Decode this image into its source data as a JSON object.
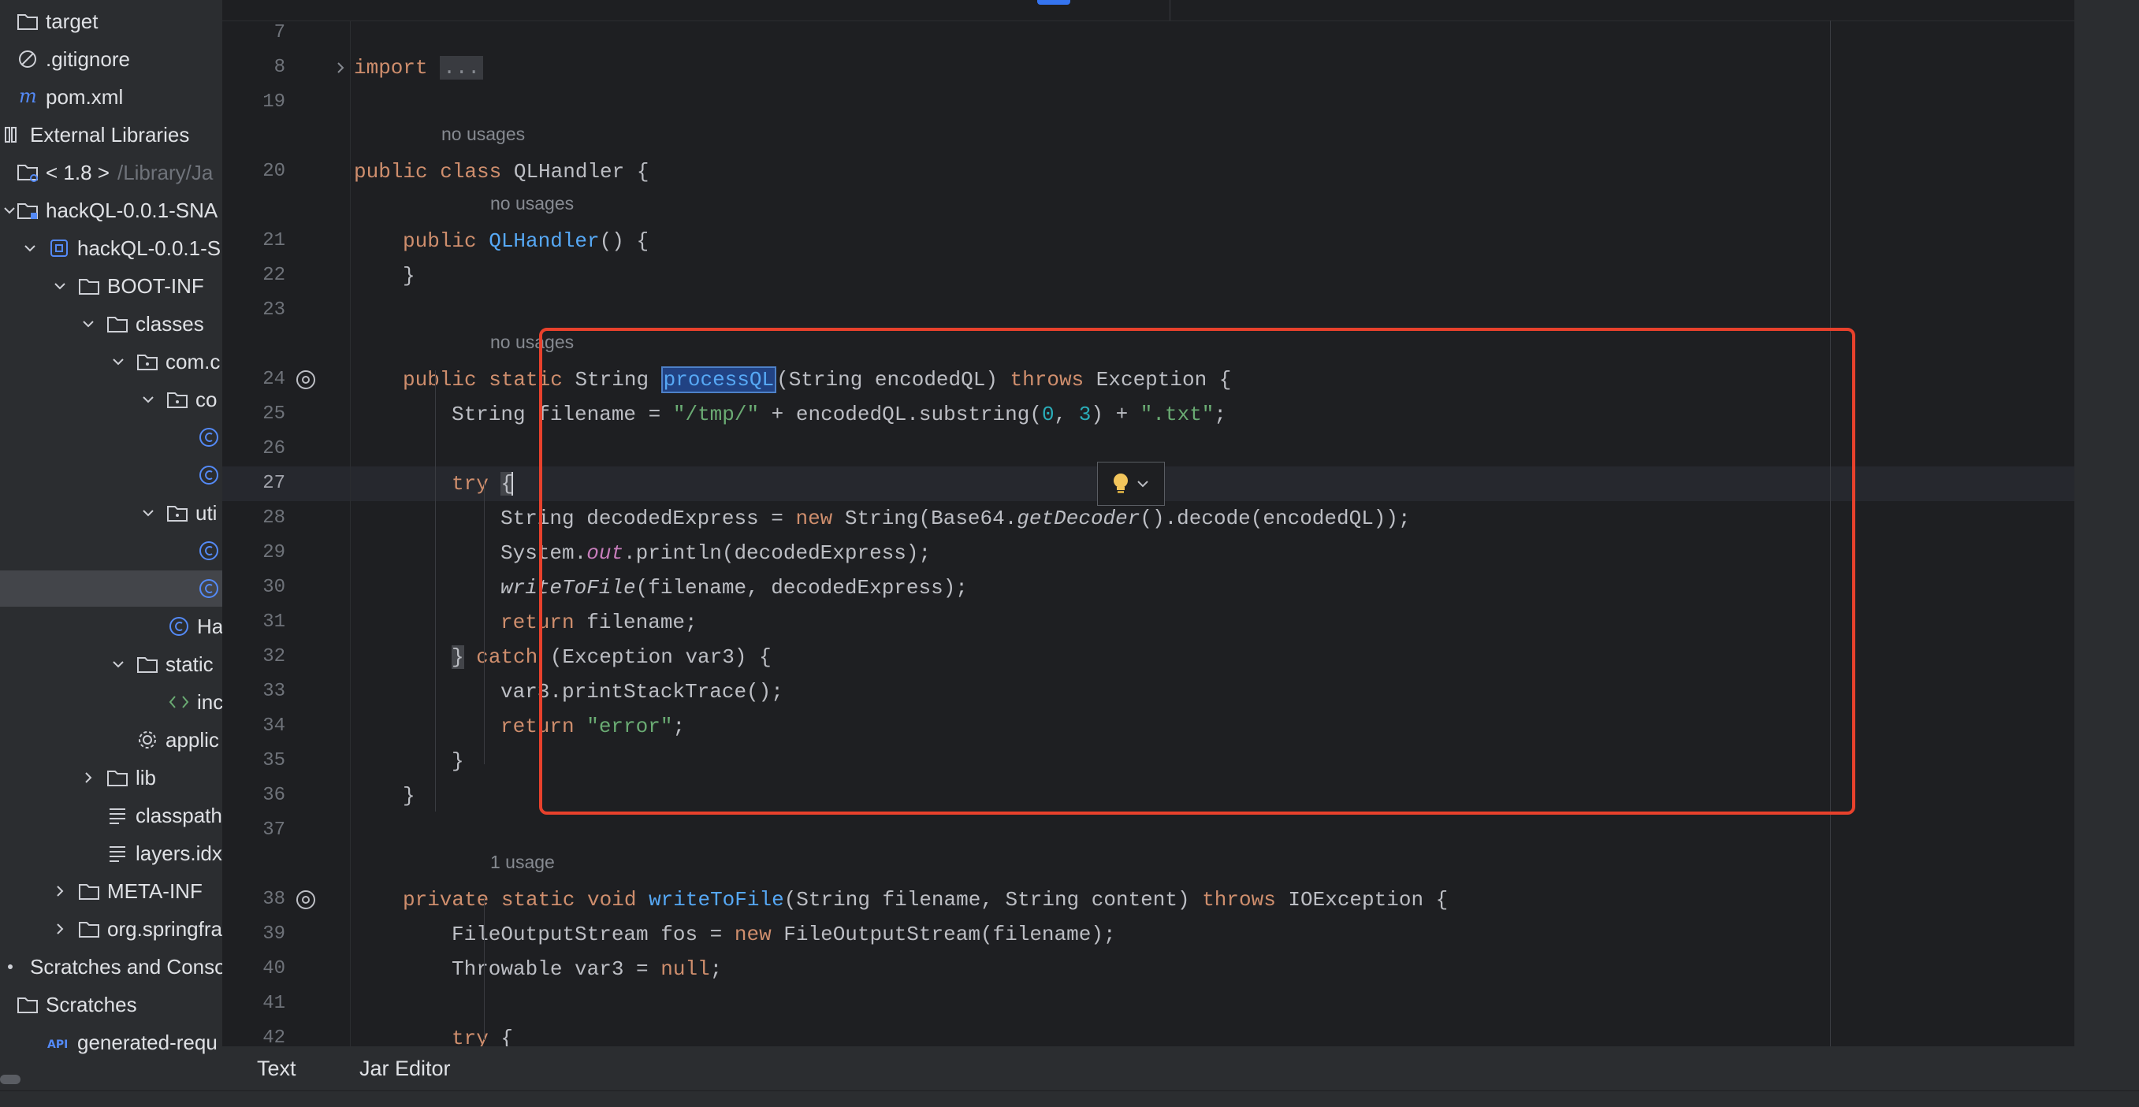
{
  "tree": [
    {
      "label": "target",
      "icon": "folder-icon",
      "indent": 20,
      "chev": "none"
    },
    {
      "label": ".gitignore",
      "icon": "ignore-file-icon",
      "indent": 20,
      "chev": "none"
    },
    {
      "label": "pom.xml",
      "icon": "maven-icon",
      "indent": 20,
      "chev": "none"
    },
    {
      "label": "External Libraries",
      "icon": "library-icon",
      "indent": 0,
      "chev": "none"
    },
    {
      "label": "< 1.8 >",
      "icon": "jdk-icon",
      "indent": 20,
      "chev": "none",
      "extra": "/Library/Ja"
    },
    {
      "label": "hackQL-0.0.1-SNA",
      "icon": "jar-folder-icon",
      "indent": 20,
      "chev": "down",
      "chev_left": 0
    },
    {
      "label": "hackQL-0.0.1-S",
      "icon": "jar-icon",
      "indent": 60,
      "chev": "down"
    },
    {
      "label": "BOOT-INF",
      "icon": "folder-icon",
      "indent": 98,
      "chev": "down"
    },
    {
      "label": "classes",
      "icon": "folder-icon",
      "indent": 134,
      "chev": "down"
    },
    {
      "label": "com.c",
      "icon": "package-icon",
      "indent": 172,
      "chev": "down"
    },
    {
      "label": "co",
      "icon": "package-icon",
      "indent": 210,
      "chev": "down"
    },
    {
      "label": "",
      "icon": "class-icon",
      "indent": 250,
      "chev": "none"
    },
    {
      "label": "",
      "icon": "class-icon",
      "indent": 250,
      "chev": "none"
    },
    {
      "label": "uti",
      "icon": "package-icon",
      "indent": 210,
      "chev": "down"
    },
    {
      "label": "",
      "icon": "class-icon",
      "indent": 250,
      "chev": "none"
    },
    {
      "label": "",
      "icon": "class-icon",
      "indent": 250,
      "chev": "none",
      "selected": true
    },
    {
      "label": "Ha",
      "icon": "class-icon",
      "indent": 212,
      "chev": "none"
    },
    {
      "label": "static",
      "icon": "folder-icon",
      "indent": 172,
      "chev": "down"
    },
    {
      "label": "inc",
      "icon": "html-icon",
      "indent": 212,
      "chev": "none"
    },
    {
      "label": "applic",
      "icon": "settings-file-icon",
      "indent": 172,
      "chev": "none"
    },
    {
      "label": "lib",
      "icon": "folder-icon",
      "indent": 134,
      "chev": "right"
    },
    {
      "label": "classpath",
      "icon": "text-file-icon",
      "indent": 134,
      "chev": "none"
    },
    {
      "label": "layers.idx",
      "icon": "text-file-icon",
      "indent": 134,
      "chev": "none"
    },
    {
      "label": "META-INF",
      "icon": "folder-icon",
      "indent": 98,
      "chev": "right"
    },
    {
      "label": "org.springfra",
      "icon": "folder-icon",
      "indent": 98,
      "chev": "right"
    },
    {
      "label": "Scratches and Conso",
      "icon": "scratches-icon",
      "indent": 0,
      "chev": "none"
    },
    {
      "label": "Scratches",
      "icon": "folder-icon",
      "indent": 20,
      "chev": "none"
    },
    {
      "label": "generated-requ",
      "icon": "api-icon",
      "indent": 60,
      "chev": "none"
    }
  ],
  "editor": {
    "lines": [
      {
        "n": "7",
        "indent": 0,
        "tokens": []
      },
      {
        "n": "8",
        "indent": 0,
        "fold": true,
        "tokens": [
          {
            "t": "import ",
            "c": "kw"
          },
          {
            "t": "...",
            "c": "fold-box"
          }
        ]
      },
      {
        "n": "19",
        "indent": 0,
        "tokens": []
      },
      {
        "n": "20",
        "indent": 0,
        "hint": "no usages",
        "tokens": [
          {
            "t": "public class ",
            "c": "kw"
          },
          {
            "t": "QLHandler {"
          }
        ]
      },
      {
        "n": "21",
        "indent": 1,
        "hint": "no usages",
        "tokens": [
          {
            "t": "public ",
            "c": "kw"
          },
          {
            "t": "QLHandler",
            "c": "fn"
          },
          {
            "t": "() {"
          }
        ]
      },
      {
        "n": "22",
        "indent": 1,
        "tokens": [
          {
            "t": "}"
          }
        ]
      },
      {
        "n": "23",
        "indent": 0,
        "tokens": []
      },
      {
        "n": "24",
        "indent": 1,
        "hint": "no usages",
        "at": true,
        "tokens": [
          {
            "t": "public static ",
            "c": "kw"
          },
          {
            "t": "String "
          },
          {
            "t": "processQL",
            "c": "fn hl"
          },
          {
            "t": "(String encodedQL) "
          },
          {
            "t": "throws ",
            "c": "kw"
          },
          {
            "t": "Exception {"
          }
        ]
      },
      {
        "n": "25",
        "indent": 2,
        "tokens": [
          {
            "t": "String filename = "
          },
          {
            "t": "\"/tmp/\"",
            "c": "str"
          },
          {
            "t": " + encodedQL.substring("
          },
          {
            "t": "0",
            "c": "num"
          },
          {
            "t": ", "
          },
          {
            "t": "3",
            "c": "num"
          },
          {
            "t": ") + "
          },
          {
            "t": "\".txt\"",
            "c": "str"
          },
          {
            "t": ";"
          }
        ]
      },
      {
        "n": "26",
        "indent": 0,
        "tokens": []
      },
      {
        "n": "27",
        "indent": 2,
        "current": true,
        "tokens": [
          {
            "t": "try ",
            "c": "kw"
          },
          {
            "t": "{",
            "c": "brace-m"
          }
        ]
      },
      {
        "n": "28",
        "indent": 3,
        "tokens": [
          {
            "t": "String decodedExpress = "
          },
          {
            "t": "new ",
            "c": "kw"
          },
          {
            "t": "String(Base64."
          },
          {
            "t": "getDecoder",
            "c": "it"
          },
          {
            "t": "().decode(encodedQL));"
          }
        ]
      },
      {
        "n": "29",
        "indent": 3,
        "tokens": [
          {
            "t": "System."
          },
          {
            "t": "out",
            "c": "stat"
          },
          {
            "t": ".println(decodedExpress);"
          }
        ]
      },
      {
        "n": "30",
        "indent": 3,
        "tokens": [
          {
            "t": "writeToFile",
            "c": "it"
          },
          {
            "t": "(filename, decodedExpress);"
          }
        ]
      },
      {
        "n": "31",
        "indent": 3,
        "tokens": [
          {
            "t": "return ",
            "c": "kw"
          },
          {
            "t": "filename;"
          }
        ]
      },
      {
        "n": "32",
        "indent": 2,
        "tokens": [
          {
            "t": "}",
            "c": "brace-m"
          },
          {
            "t": " catch ",
            "c": "kw"
          },
          {
            "t": "(Exception var3) {"
          }
        ]
      },
      {
        "n": "33",
        "indent": 3,
        "tokens": [
          {
            "t": "var3.printStackTrace();"
          }
        ]
      },
      {
        "n": "34",
        "indent": 3,
        "tokens": [
          {
            "t": "return ",
            "c": "kw"
          },
          {
            "t": "\"error\"",
            "c": "str"
          },
          {
            "t": ";"
          }
        ]
      },
      {
        "n": "35",
        "indent": 2,
        "tokens": [
          {
            "t": "}"
          }
        ]
      },
      {
        "n": "36",
        "indent": 1,
        "tokens": [
          {
            "t": "}"
          }
        ]
      },
      {
        "n": "37",
        "indent": 0,
        "tokens": []
      },
      {
        "n": "38",
        "indent": 1,
        "hint": "1 usage",
        "at": true,
        "tokens": [
          {
            "t": "private static void ",
            "c": "kw"
          },
          {
            "t": "writeToFile",
            "c": "fn"
          },
          {
            "t": "(String filename, String content) "
          },
          {
            "t": "throws ",
            "c": "kw"
          },
          {
            "t": "IOException {"
          }
        ]
      },
      {
        "n": "39",
        "indent": 2,
        "tokens": [
          {
            "t": "FileOutputStream fos = "
          },
          {
            "t": "new ",
            "c": "kw"
          },
          {
            "t": "FileOutputStream(filename);"
          }
        ]
      },
      {
        "n": "40",
        "indent": 2,
        "tokens": [
          {
            "t": "Throwable var3 = "
          },
          {
            "t": "null",
            "c": "kw"
          },
          {
            "t": ";"
          }
        ]
      },
      {
        "n": "41",
        "indent": 0,
        "tokens": []
      },
      {
        "n": "42",
        "indent": 2,
        "tokens": [
          {
            "t": "try ",
            "c": "kw"
          },
          {
            "t": "{"
          }
        ]
      }
    ]
  },
  "bottom_tabs": [
    {
      "label": "Text",
      "active": true
    },
    {
      "label": "Jar Editor",
      "active": false
    }
  ],
  "colors": {
    "highlight_box": "#e8412c",
    "accent": "#3574f0"
  }
}
